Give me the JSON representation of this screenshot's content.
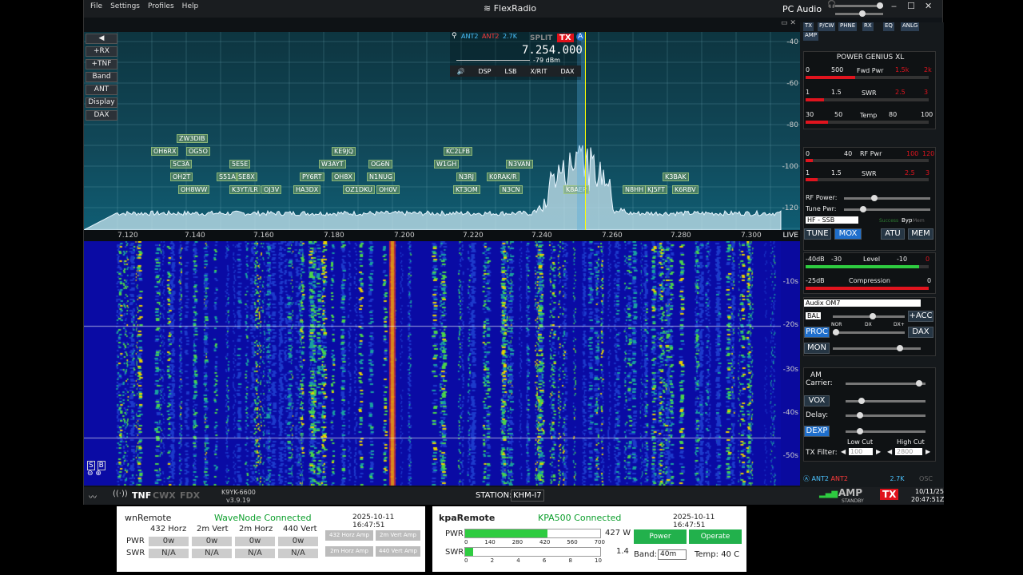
{
  "menu": [
    "File",
    "Settings",
    "Profiles",
    "Help"
  ],
  "brand": "FlexRadio",
  "pc_audio": "PC Audio",
  "left_buttons": [
    "+RX",
    "+TNF",
    "Band",
    "ANT",
    "Display",
    "DAX"
  ],
  "db_ticks": [
    "-40",
    "-60",
    "-80",
    "-100",
    "-120"
  ],
  "freq_ticks": [
    "7.120",
    "7.140",
    "7.160",
    "7.180",
    "7.200",
    "7.220",
    "7.240",
    "7.260",
    "7.280",
    "7.300"
  ],
  "live": "LIVE",
  "slice": {
    "ant1": "ANT2",
    "ant2": "ANT2",
    "bw": "2.7K",
    "split": "SPLIT",
    "tx": "TX",
    "letter": "A",
    "freq": "7.254.000",
    "dbm": "-79 dBm",
    "buttons": [
      "DSP",
      "LSB",
      "X/RIT",
      "DAX"
    ]
  },
  "spots": [
    [
      "ZW3DIB",
      116,
      168
    ],
    [
      "OH6RX",
      84,
      184
    ],
    [
      "OG5O",
      128,
      184
    ],
    [
      "5C3A",
      108,
      200
    ],
    [
      "5E5E",
      182,
      200
    ],
    [
      "OH2T",
      108,
      216
    ],
    [
      "S51A",
      166,
      216
    ],
    [
      "SE8X",
      190,
      216
    ],
    [
      "OH8WW",
      118,
      232
    ],
    [
      "K3YT/LR",
      182,
      232
    ],
    [
      "OJ3V",
      222,
      232
    ],
    [
      "KE9JQ",
      310,
      184
    ],
    [
      "W3AYT",
      294,
      200
    ],
    [
      "PY6RT",
      270,
      216
    ],
    [
      "OH8X",
      310,
      216
    ],
    [
      "HA3DX",
      262,
      232
    ],
    [
      "OZ1DKU",
      324,
      232
    ],
    [
      "OG6N",
      356,
      200
    ],
    [
      "N1NUG",
      354,
      216
    ],
    [
      "OH0V",
      366,
      232
    ],
    [
      "KC2LFB",
      450,
      184
    ],
    [
      "W1GH",
      438,
      200
    ],
    [
      "N3VAN",
      528,
      200
    ],
    [
      "N3RJ",
      466,
      216
    ],
    [
      "K0RAK/R",
      504,
      216
    ],
    [
      "KT3OM",
      462,
      232
    ],
    [
      "N3CN",
      520,
      232
    ],
    [
      "K8AEP",
      600,
      232
    ],
    [
      "N8HH",
      674,
      232
    ],
    [
      "KJ5FT",
      702,
      232
    ],
    [
      "K3BAK",
      724,
      216
    ],
    [
      "K6RBV",
      736,
      232
    ]
  ],
  "wf_ticks": [
    "-10s",
    "-20s",
    "-30s",
    "-40s",
    "-50s"
  ],
  "status": {
    "tnf": "TNF",
    "cwx": "CWX",
    "fdx": "FDX",
    "callsign": "K9YK-6600",
    "version": "v3.9.19",
    "station_label": "STATION:",
    "station": "KHM-I7",
    "amp": "AMP",
    "standby": "STANDBY",
    "tx": "TX",
    "date": "10/11/25",
    "time": "20:47:51Z"
  },
  "tabs": [
    "TX",
    "P/CW",
    "PHNE",
    "RX",
    "EQ",
    "ANLG",
    "AMP"
  ],
  "amp": {
    "title": "POWER GENIUS XL",
    "fwd": [
      "0",
      "500",
      "Fwd Pwr",
      "1.5k",
      "2k"
    ],
    "swr": [
      "1",
      "1.5",
      "SWR",
      "2.5",
      "3"
    ],
    "temp": [
      "30",
      "50",
      "Temp",
      "80",
      "100"
    ]
  },
  "txp": {
    "rfpwr": [
      "0",
      "40",
      "RF Pwr",
      "100",
      "120"
    ],
    "swr": [
      "1",
      "1.5",
      "SWR",
      "2.5",
      "3"
    ],
    "rf_power": "RF Power:",
    "tune_pwr": "Tune Pwr:",
    "profile": "HF - SSB",
    "success": "Success",
    "byp": "Byp",
    "mem_small": "Mem",
    "tune": "TUNE",
    "mox": "MOX",
    "atu": "ATU",
    "mem": "MEM"
  },
  "phne": {
    "lvl": [
      "-40dB",
      "-30",
      "Level",
      "-10",
      "0"
    ],
    "comp": [
      "-25dB",
      "Compression",
      "0"
    ],
    "mic": "Audix OM7",
    "bal": "BAL",
    "acc": "+ACC",
    "proc": "PROC",
    "nor": "NOR",
    "dx": "DX",
    "dxp": "DX+",
    "dax": "DAX",
    "mon": "MON"
  },
  "anlg": {
    "am": "AM",
    "carrier": "Carrier:",
    "vox": "VOX",
    "delay": "Delay:",
    "dexp": "DEXP",
    "low": "Low Cut",
    "high": "High Cut",
    "txf": "TX Filter:",
    "lowv": "100",
    "highv": "2800"
  },
  "foot": {
    "ant1": "ANT2",
    "ant2": "ANT2",
    "bw": "2.7K",
    "osc": "OSC"
  },
  "wn": {
    "title": "wnRemote",
    "status": "WaveNode Connected",
    "ts": "2025-10-11 16:47:51",
    "cols": [
      "432 Horz",
      "2m Vert",
      "2m Horz",
      "440 Vert"
    ],
    "pwr_label": "PWR",
    "swr_label": "SWR",
    "pwr": [
      "0w",
      "0w",
      "0w",
      "0w"
    ],
    "swr": [
      "N/A",
      "N/A",
      "N/A",
      "N/A"
    ],
    "amps": [
      "432 Horz Amp",
      "2m Vert Amp",
      "2m Horz Amp",
      "440 Vert Amp"
    ]
  },
  "kpa": {
    "title": "kpaRemote",
    "status": "KPA500 Connected",
    "ts": "2025-10-11 16:47:51",
    "pwr_label": "PWR",
    "pwr_val": "427 W",
    "pwr_fraction": 0.61,
    "pwr_ticks": [
      "0",
      "140",
      "280",
      "420",
      "560",
      "700"
    ],
    "swr_label": "SWR",
    "swr_val": "1.4",
    "swr_fraction": 0.06,
    "swr_ticks": [
      "0",
      "2",
      "4",
      "6",
      "8",
      "10"
    ],
    "power": "Power",
    "operate": "Operate",
    "band_label": "Band:",
    "band": "40m",
    "temp": "Temp: 40 C"
  }
}
